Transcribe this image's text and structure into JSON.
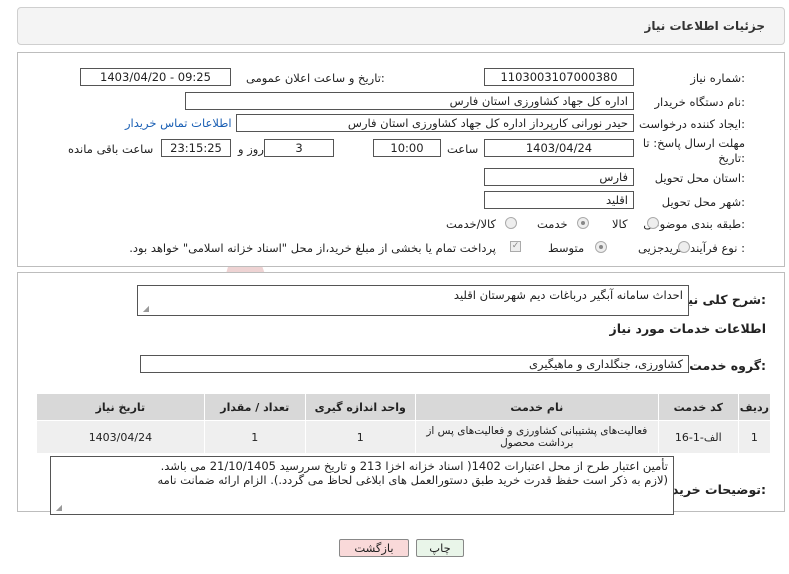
{
  "header": {
    "title": "جزئیات اطلاعات نیاز"
  },
  "form": {
    "need_number_label": "شماره نیاز:",
    "need_number": "1103003107000380",
    "announce_label": "تاریخ و ساعت اعلان عمومی:",
    "announce_value": "1403/04/20 - 09:25",
    "buyer_org_label": "نام دستگاه خریدار:",
    "buyer_org": "اداره کل جهاد کشاورزی استان فارس",
    "creator_label": "ایجاد کننده درخواست:",
    "creator": "حیدر نورانی کارپرداز اداره کل جهاد کشاورزی استان فارس",
    "contact_link": "اطلاعات تماس خریدار",
    "deadline_label_1": "مهلت ارسال پاسخ: تا",
    "deadline_label_2": "تاریخ:",
    "deadline_date": "1403/04/24",
    "time_label": "ساعت",
    "deadline_time": "10:00",
    "days_value": "3",
    "days_label": "روز و",
    "remaining_time": "23:15:25",
    "remaining_label": "ساعت باقی مانده",
    "province_label": "استان محل تحویل:",
    "province": "فارس",
    "city_label": "شهر محل تحویل:",
    "city": "اقلید",
    "category_label": "طبقه بندی موضوعی:",
    "category_options": [
      "کالا",
      "خدمت",
      "کالا/خدمت"
    ],
    "category_selected": "خدمت",
    "process_label": "نوع فرآیند خرید :",
    "process_options": [
      "جزیی",
      "متوسط"
    ],
    "process_selected": "متوسط",
    "payment_note": "پرداخت تمام یا بخشی از مبلغ خرید،از محل \"اسناد خزانه اسلامی\" خواهد بود."
  },
  "need": {
    "summary_label": "شرح کلی نیاز:",
    "summary": "احداث سامانه آبگیر درباغات دیم شهرستان اقلید",
    "services_heading": "اطلاعات خدمات مورد نیاز",
    "group_label": "گروه خدمت:",
    "group": "کشاورزی، جنگلداری و ماهیگیری"
  },
  "table": {
    "headers": [
      "ردیف",
      "کد خدمت",
      "نام خدمت",
      "واحد اندازه گیری",
      "تعداد / مقدار",
      "تاریخ نیاز"
    ],
    "rows": [
      [
        "1",
        "الف-1-16",
        "فعالیت‌های پشتیبانی کشاورزی و فعالیت‌های پس از برداشت محصول",
        "1",
        "1",
        "1403/04/24"
      ]
    ]
  },
  "buyer_notes": {
    "label": "توضیحات خریدار:",
    "line1": "تأمین اعتبار طرح از محل اعتبارات 1402( اسناد خزانه اخزا 213 و  تاریخ سررسید 21/10/1405 می باشد.",
    "line2": "(لازم به ذکر است حفظ قدرت خرید طبق دستورالعمل های ابلاغی لحاظ می گردد.). الزام ارائه ضمانت نامه"
  },
  "buttons": {
    "print": "چاپ",
    "back": "بازگشت"
  },
  "watermark": {
    "text": "AriaTender.neT"
  },
  "colors": {
    "link": "#1a5fb4",
    "back_button_bg": "#f9d9d9",
    "print_button_bg": "#e9f5e9",
    "watermark": "#e8c8c8"
  }
}
